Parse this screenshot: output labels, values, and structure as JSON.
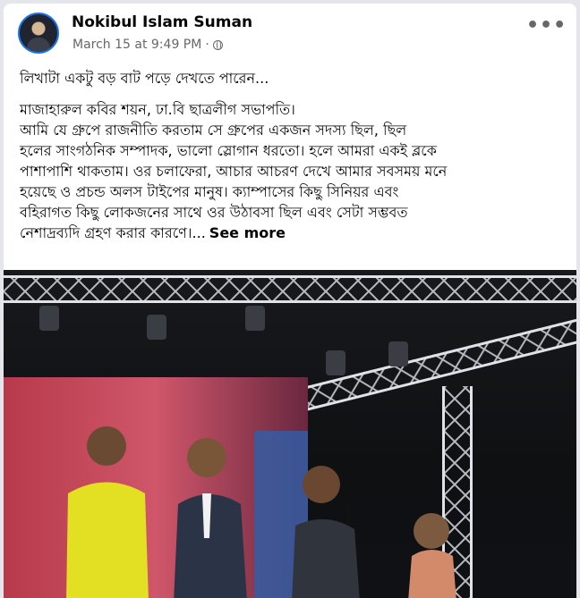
{
  "post": {
    "author": "Nokibul Islam Suman",
    "timestamp": "March 15 at 9:49 PM",
    "separator": "·",
    "privacy_icon": "globe-icon",
    "more_label": "•••",
    "text_intro": "লিখাটা একটু বড় বাট পড়ে দেখতে পারেন...",
    "text_lines": [
      "মাজাহারুল কবির শয়ন, ঢা.বি ছাত্রলীগ সভাপতি।",
      "আমি যে গ্রুপে রাজনীতি করতাম সে গ্রুপের একজন সদস্য ছিল, ছিল",
      "হলের সাংগঠনিক সম্পাদক, ভালো স্লোগান ধরতো। হলে আমরা একই ব্লকে",
      "পাশাপাশি থাকতাম। ওর চলাফেরা, আচার আচরণ দেখে আমার সবসময় মনে",
      "হয়েছে ও প্রচন্ড অলস টাইপের মানুষ। ক্যাম্পাসের কিছু সিনিয়র এবং",
      "বহিরাগত কিছু লোকজনের সাথে ওর উঠাবসা ছিল এবং সেটা সম্ভবত",
      "নেশাদ্রব্যদি গ্রহণ করার কারণে।..."
    ],
    "see_more": "See more",
    "photo_alt": "Four people standing on a stage under lighting truss, one holding a microphone"
  },
  "colors": {
    "text": "#050505",
    "secondary": "#65676b",
    "avatar_ring": "#1b74e4",
    "background": "#e4e6eb"
  }
}
